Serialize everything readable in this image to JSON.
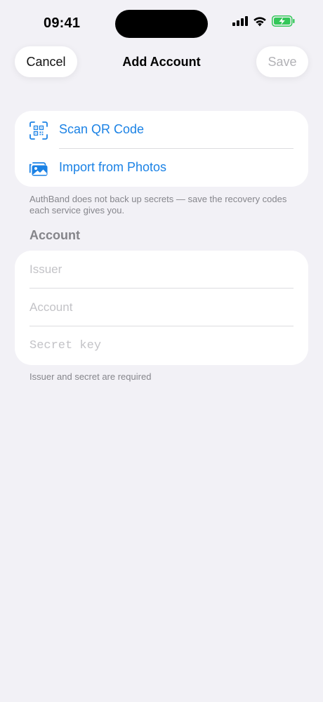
{
  "status_bar": {
    "time": "09:41"
  },
  "nav": {
    "cancel_label": "Cancel",
    "title": "Add Account",
    "save_label": "Save"
  },
  "import_options": [
    {
      "label": "Scan QR Code",
      "icon": "qr-code-icon"
    },
    {
      "label": "Import from Photos",
      "icon": "photos-icon"
    }
  ],
  "backup_note": "AuthBand does not back up secrets — save the recovery codes each service gives you.",
  "account_section": {
    "header": "Account",
    "fields": [
      {
        "placeholder": "Issuer",
        "value": ""
      },
      {
        "placeholder": "Account",
        "value": ""
      },
      {
        "placeholder": "Secret key",
        "value": ""
      }
    ]
  },
  "required_note": "Issuer and secret are required",
  "colors": {
    "accent": "#1b82e5",
    "background": "#f2f1f6",
    "battery": "#34c759"
  }
}
